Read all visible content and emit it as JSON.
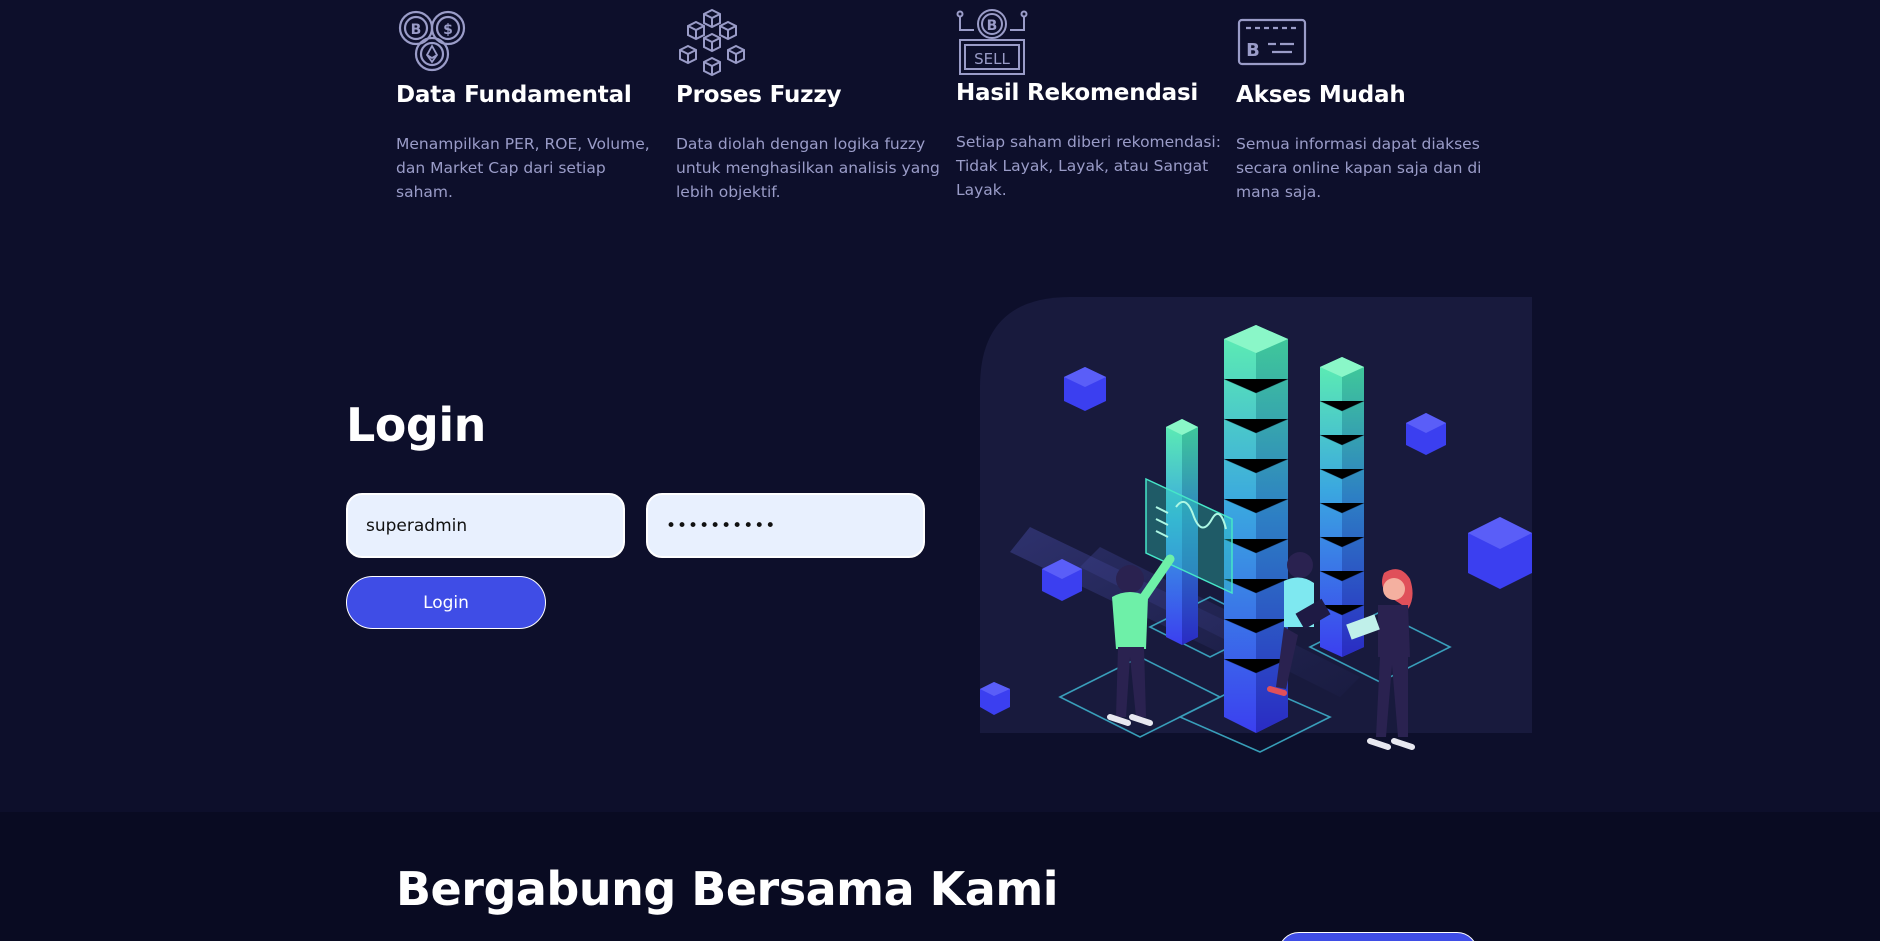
{
  "features": [
    {
      "icon": "crypto-coins-icon",
      "title": "Data Fundamental",
      "desc": "Menampilkan PER, ROE, Volume, dan Market Cap dari setiap saham."
    },
    {
      "icon": "blockchain-cubes-icon",
      "title": "Proses Fuzzy",
      "desc": "Data diolah dengan logika fuzzy untuk menghasilkan analisis yang lebih objektif."
    },
    {
      "icon": "bitcoin-sell-sign-icon",
      "title": "Hasil Rekomendasi",
      "desc": "Setiap saham diberi rekomendasi: Tidak Layak, Layak, atau Sangat Layak."
    },
    {
      "icon": "bitcoin-card-icon",
      "title": "Akses Mudah",
      "desc": "Semua informasi dapat diakses secara online kapan saja dan di mana saja."
    }
  ],
  "login": {
    "title": "Login",
    "username_value": "superadmin",
    "password_value": "••••••••••",
    "button_label": "Login"
  },
  "illustration": {
    "icon": "data-towers-illustration"
  },
  "join": {
    "title": "Bergabung Bersama Kami"
  },
  "colors": {
    "background": "#0d0f2b",
    "accent": "#3f4de6",
    "muted_text": "#9a9cc8",
    "input_bg": "#e8f0fe"
  }
}
